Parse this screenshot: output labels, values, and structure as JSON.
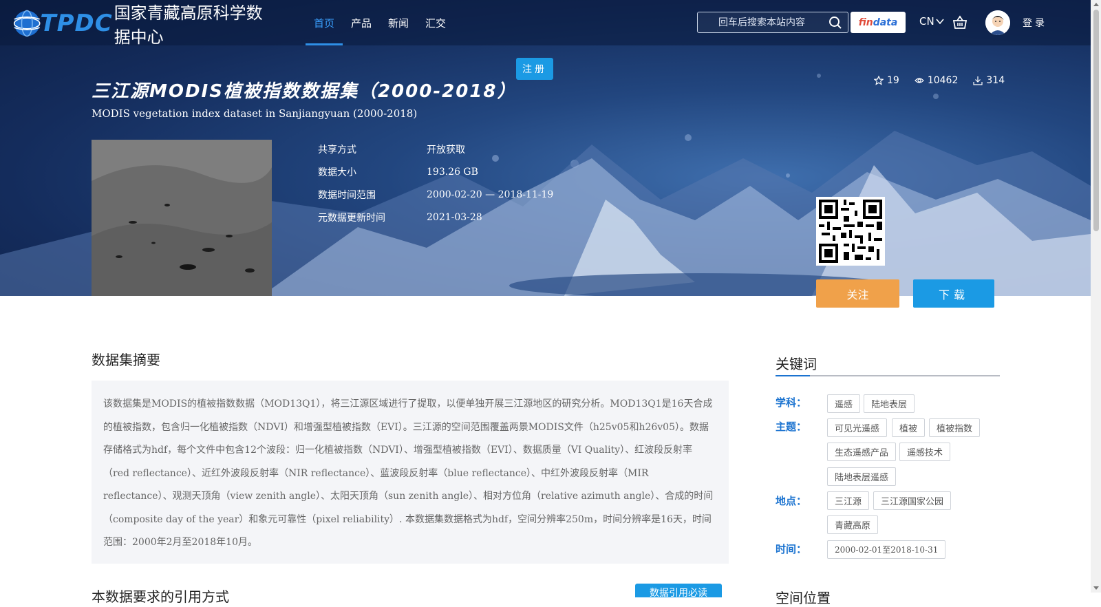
{
  "header": {
    "logo_text": "TPDC",
    "logo_name": "国家青藏高原科学数据中心",
    "nav": [
      {
        "label": "首页",
        "active": true
      },
      {
        "label": "产品",
        "active": false
      },
      {
        "label": "新闻",
        "active": false
      },
      {
        "label": "汇交",
        "active": false
      }
    ],
    "search_placeholder": "回车后搜索本站内容",
    "findata_a": "fin",
    "findata_b": "data",
    "lang": "CN",
    "login": "登录",
    "register": "注册"
  },
  "dataset": {
    "title": "三江源MODIS植被指数数据集（2000-2018）",
    "subtitle": "MODIS vegetation index dataset in Sanjiangyuan (2000-2018)",
    "stats": {
      "stars": "19",
      "views": "10462",
      "downloads": "314"
    },
    "meta": [
      {
        "key": "共享方式",
        "value": "开放获取"
      },
      {
        "key": "数据大小",
        "value": "193.26 GB"
      },
      {
        "key": "数据时间范围",
        "value": "2000-02-20 — 2018-11-19"
      },
      {
        "key": "元数据更新时间",
        "value": "2021-03-28"
      }
    ],
    "follow": "关注",
    "download": "下载"
  },
  "abstract": {
    "title": "数据集摘要",
    "text": "该数据集是MODIS的植被指数数据（MOD13Q1），将三江源区域进行了提取，以便单独开展三江源地区的研究分析。MOD13Q1是16天合成的植被指数，包含归一化植被指数（NDVI）和增强型植被指数（EVI）。三江源的空间范围覆盖两景MODIS文件（h25v05和h26v05）。数据存储格式为hdf，每个文件中包含12个波段：归一化植被指数（NDVI）、增强型植被指数（EVI）、数据质量（VI Quality）、红波段反射率（red reflectance）、近红外波段反射率（NIR reflectance）、蓝波段反射率（blue reflectance）、中红外波段反射率（MIR reflectance）、观测天顶角（view zenith angle）、太阳天顶角（sun zenith angle）、相对方位角（relative azimuth angle）、合成的时间（composite day of the year）和象元可靠性（pixel reliability）. 本数据集数据格式为hdf，空间分辨率250m，时间分辨率是16天，时间范围：2000年2月至2018年10月。"
  },
  "citation": {
    "title": "本数据要求的引用方式",
    "button": "数据引用必读"
  },
  "keywords": {
    "title": "关键词",
    "subject_label": "学科：",
    "subject": [
      "遥感",
      "陆地表层"
    ],
    "theme_label": "主题：",
    "theme": [
      "可见光遥感",
      "植被",
      "植被指数",
      "生态遥感产品",
      "遥感技术",
      "陆地表层遥感"
    ],
    "place_label": "地点：",
    "place": [
      "三江源",
      "三江源国家公园",
      "青藏高原"
    ],
    "time_label": "时间：",
    "time": [
      "2000-02-01至2018-10-31"
    ]
  },
  "space": {
    "title": "空间位置"
  },
  "colors": {
    "accent": "#1b9ae4",
    "follow": "#f0a14a",
    "keyword_label": "#1b73d0"
  }
}
